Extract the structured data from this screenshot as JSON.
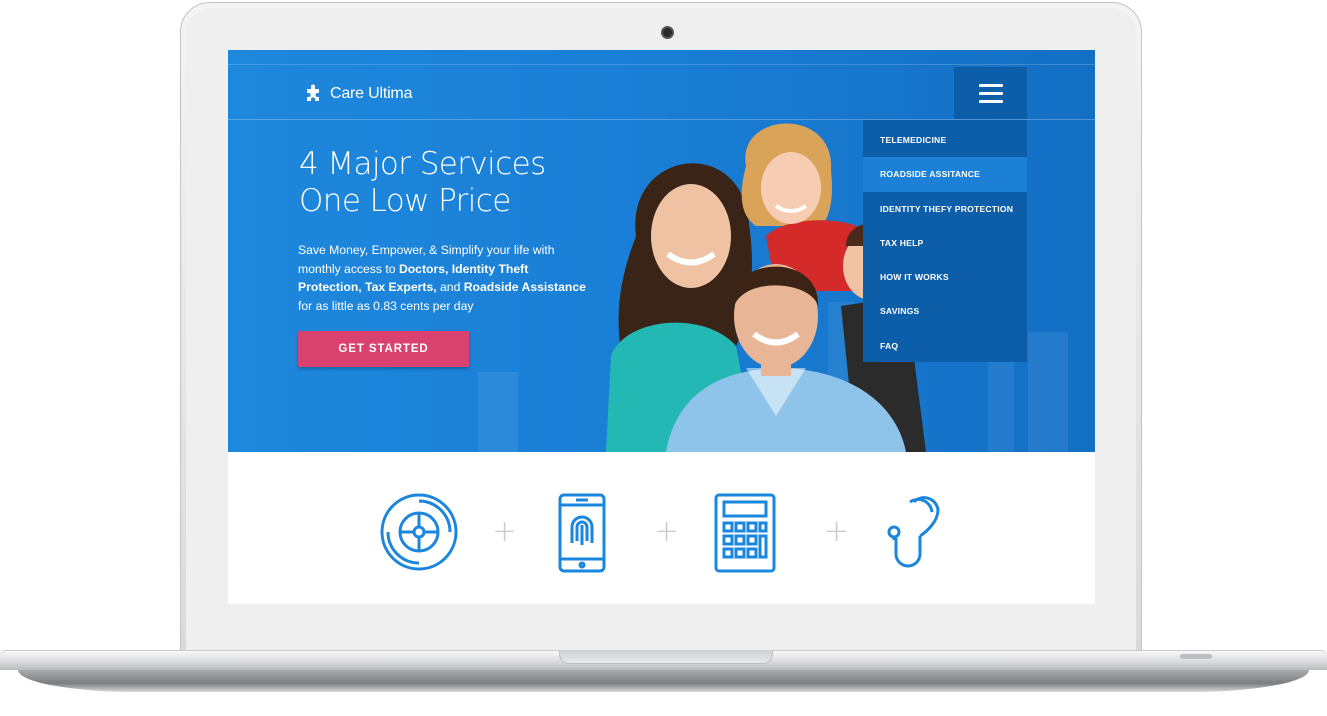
{
  "brand": {
    "name": "Care Ultima",
    "accent_color": "#1a7fd6",
    "cta_color": "#d9416e",
    "menu_color": "#0d5ea8",
    "logo_icon": "puzzle-piece-icon"
  },
  "hero": {
    "headline_line1": "4 Major Services",
    "headline_line2": "One Low Price",
    "intro_part1": "Save Money, Empower, & Simplify your life with monthly access to ",
    "intro_bold1": "Doctors, Identity Theft Protection, Tax Experts,",
    "intro_part2": " and ",
    "intro_bold2": "Roadside Assistance",
    "intro_part3": " for as little as 0.83 cents per day",
    "cta_label": "GET STARTED"
  },
  "nav": {
    "toggle_icon": "hamburger-menu-icon",
    "items": [
      {
        "label": "TELEMEDICINE",
        "active": false
      },
      {
        "label": "ROADSIDE ASSITANCE",
        "active": true
      },
      {
        "label": "IDENTITY THEFY PROTECTION",
        "active": false
      },
      {
        "label": "TAX HELP",
        "active": false
      },
      {
        "label": "HOW IT WORKS",
        "active": false
      },
      {
        "label": "SAVINGS",
        "active": false
      },
      {
        "label": "FAQ",
        "active": false
      }
    ]
  },
  "services": {
    "icons": [
      "tire-wheel-icon",
      "phone-fingerprint-icon",
      "calculator-icon",
      "stethoscope-icon"
    ],
    "separator": "+",
    "icon_color": "#1a86de"
  }
}
